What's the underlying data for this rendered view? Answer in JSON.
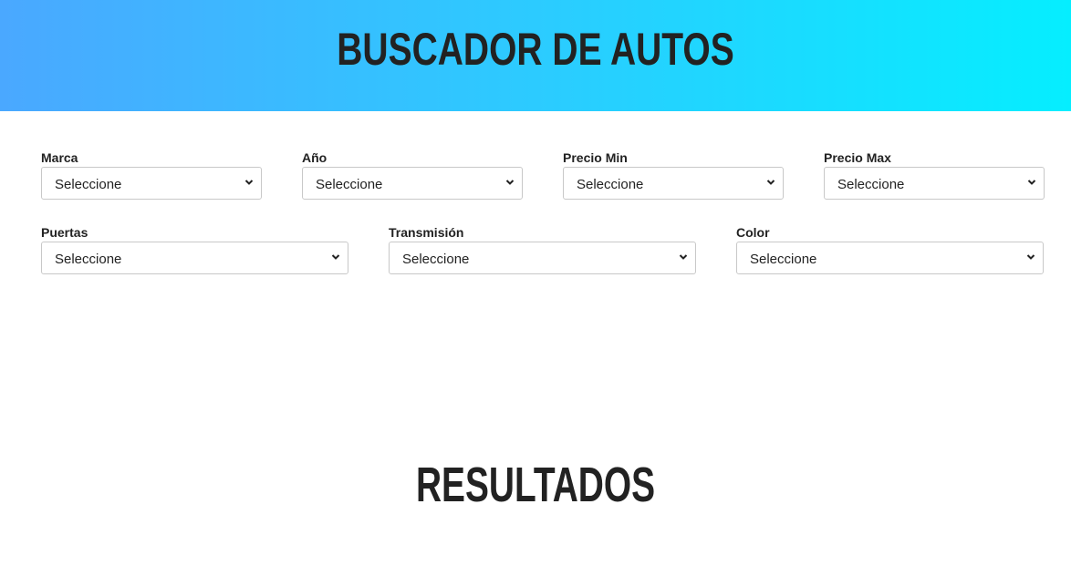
{
  "header": {
    "title": "BUSCADOR DE AUTOS"
  },
  "filters": {
    "marca": {
      "label": "Marca",
      "value": "Seleccione"
    },
    "anio": {
      "label": "Año",
      "value": "Seleccione"
    },
    "precio_min": {
      "label": "Precio Min",
      "value": "Seleccione"
    },
    "precio_max": {
      "label": "Precio Max",
      "value": "Seleccione"
    },
    "puertas": {
      "label": "Puertas",
      "value": "Seleccione"
    },
    "transmision": {
      "label": "Transmisión",
      "value": "Seleccione"
    },
    "color": {
      "label": "Color",
      "value": "Seleccione"
    }
  },
  "results": {
    "title": "RESULTADOS"
  },
  "colors": {
    "gradient_start": "#4aa8ff",
    "gradient_end": "#05eeff",
    "text": "#222222"
  }
}
